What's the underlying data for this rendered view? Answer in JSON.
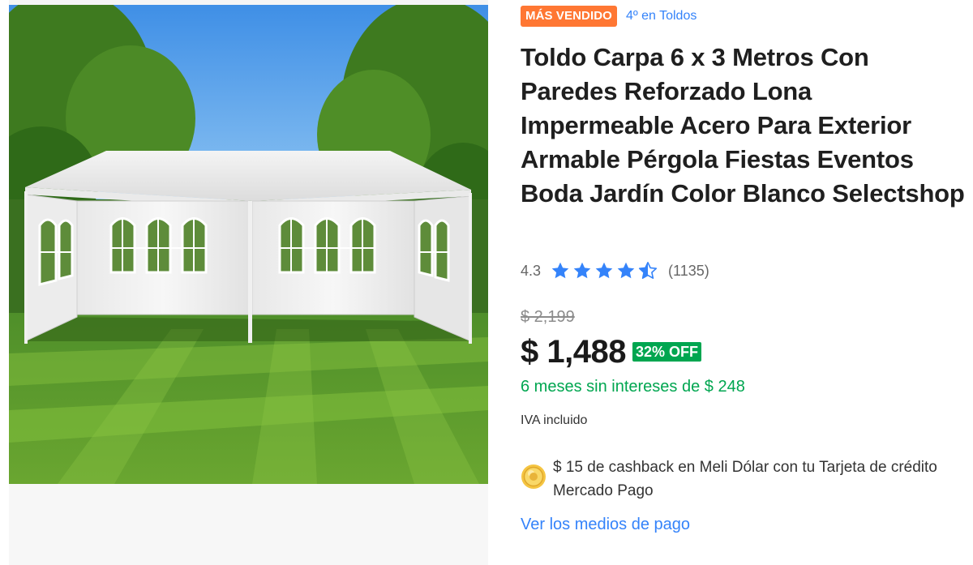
{
  "badge": {
    "label": "MÁS VENDIDO",
    "color": "#ff7733"
  },
  "rank_link": "4º en Toldos",
  "product": {
    "title": "Toldo Carpa 6 x 3 Metros Con Paredes Reforzado Lona Impermeable Acero Para Exterior Armable Pérgola Fiestas Eventos Boda Jardín Color Blanco Selectshop"
  },
  "rating": {
    "value": "4.3",
    "stars": [
      "star-full",
      "star-full",
      "star-full",
      "star-full",
      "star-half"
    ],
    "review_count": "(1135)"
  },
  "price": {
    "original": "$ 2,199",
    "current": "$ 1,488",
    "discount": "32% OFF",
    "installments": "6 meses sin intereses de $ 248",
    "tax_note": "IVA incluido"
  },
  "cashback": {
    "text": "$ 15 de cashback en Meli Dólar con tu Tarjeta de crédito Mercado Pago"
  },
  "payment_link": "Ver los medios de pago",
  "colors": {
    "accent_blue": "#3483fa",
    "discount_green": "#00a650",
    "badge_orange": "#ff7733",
    "title_dark": "#1f1f1f"
  },
  "image": {
    "subject": "white party tent on lawn",
    "icon": "product-photo"
  }
}
